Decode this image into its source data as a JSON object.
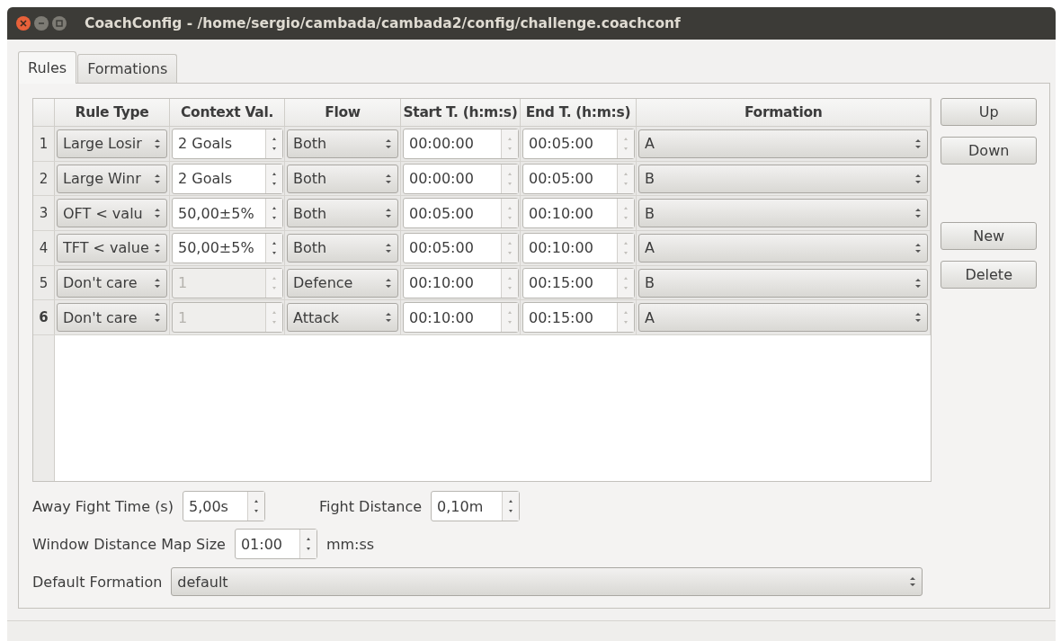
{
  "window": {
    "title": "CoachConfig - /home/sergio/cambada/cambada2/config/challenge.coachconf"
  },
  "tabs": [
    {
      "label": "Rules",
      "selected": true
    },
    {
      "label": "Formations",
      "selected": false
    }
  ],
  "table": {
    "columns": [
      "Rule Type",
      "Context Val.",
      "Flow",
      "Start T. (h:m:s)",
      "End T. (h:m:s)",
      "Formation"
    ],
    "rows": [
      {
        "number": "1",
        "current": false,
        "rule_type": "Large Losir",
        "context": "2 Goals",
        "context_disabled": false,
        "flow": "Both",
        "start": "00:00:00",
        "end": "00:05:00",
        "formation": "A"
      },
      {
        "number": "2",
        "current": false,
        "rule_type": "Large Winr",
        "context": "2 Goals",
        "context_disabled": false,
        "flow": "Both",
        "start": "00:00:00",
        "end": "00:05:00",
        "formation": "B"
      },
      {
        "number": "3",
        "current": false,
        "rule_type": "OFT < valu",
        "context": "50,00±5%",
        "context_disabled": false,
        "flow": "Both",
        "start": "00:05:00",
        "end": "00:10:00",
        "formation": "B"
      },
      {
        "number": "4",
        "current": false,
        "rule_type": "TFT < value",
        "context": "50,00±5%",
        "context_disabled": false,
        "flow": "Both",
        "start": "00:05:00",
        "end": "00:10:00",
        "formation": "A"
      },
      {
        "number": "5",
        "current": false,
        "rule_type": "Don't care",
        "context": "1",
        "context_disabled": true,
        "flow": "Defence",
        "start": "00:10:00",
        "end": "00:15:00",
        "formation": "B"
      },
      {
        "number": "6",
        "current": true,
        "rule_type": "Don't care",
        "context": "1",
        "context_disabled": true,
        "flow": "Attack",
        "start": "00:10:00",
        "end": "00:15:00",
        "formation": "A"
      }
    ]
  },
  "side_buttons": [
    "Up",
    "Down",
    "New",
    "Delete"
  ],
  "away_fight_time": {
    "label": "Away Fight Time (s)",
    "value": "5,00s"
  },
  "fight_distance": {
    "label": "Fight Distance",
    "value": "0,10m"
  },
  "window_distance": {
    "label": "Window Distance Map Size",
    "value": "01:00",
    "unit": "mm:ss"
  },
  "default_formation": {
    "label": "Default Formation",
    "value": "default"
  }
}
